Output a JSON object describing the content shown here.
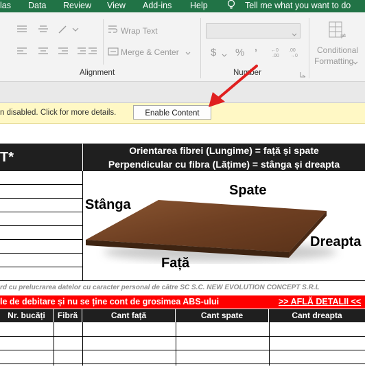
{
  "menu": {
    "items": [
      "las",
      "Data",
      "Review",
      "View",
      "Add-ins",
      "Help",
      "Tell me what you want to do"
    ]
  },
  "ribbon": {
    "wrap_text": "Wrap Text",
    "merge_center": "Merge & Center",
    "alignment_label": "Alignment",
    "number_label": "Number",
    "number_format_value": "",
    "currency_symbol": "$",
    "percent_symbol": "%",
    "comma_symbol": "’",
    "conditional_line1": "Conditional",
    "conditional_line2": "Formatting"
  },
  "message_bar": {
    "text": "n disabled. Click for more details.",
    "enable_button": "Enable Content"
  },
  "sheet": {
    "top_left_header": "T*",
    "orientation_line1": "Orientarea fibrei (Lungime) = față și spate",
    "orientation_line2": "Perpendicular cu fibra (Lățime) = stânga și dreapta",
    "label_left": "Stânga",
    "label_back": "Spate",
    "label_right": "Dreapta",
    "label_front": "Față",
    "gdpr_note": "rd cu prelucrarea datelor cu caracter personal de către SC S.C. NEW EVOLUTION CONCEPT S.R.L",
    "red_banner_text": "le de debitare și nu se ține cont de grosimea ABS-ului",
    "red_banner_link": ">> AFLĂ DETALII <<",
    "columns": [
      "Nr. bucăți",
      "Fibră",
      "Cant față",
      "Cant spate",
      "Cant dreapta"
    ]
  },
  "colors": {
    "excel_green": "#217346",
    "message_bar": "#fff8c5",
    "red_banner": "#ff0000",
    "arrow": "#e02020",
    "board_wood": "#6b3f22"
  }
}
